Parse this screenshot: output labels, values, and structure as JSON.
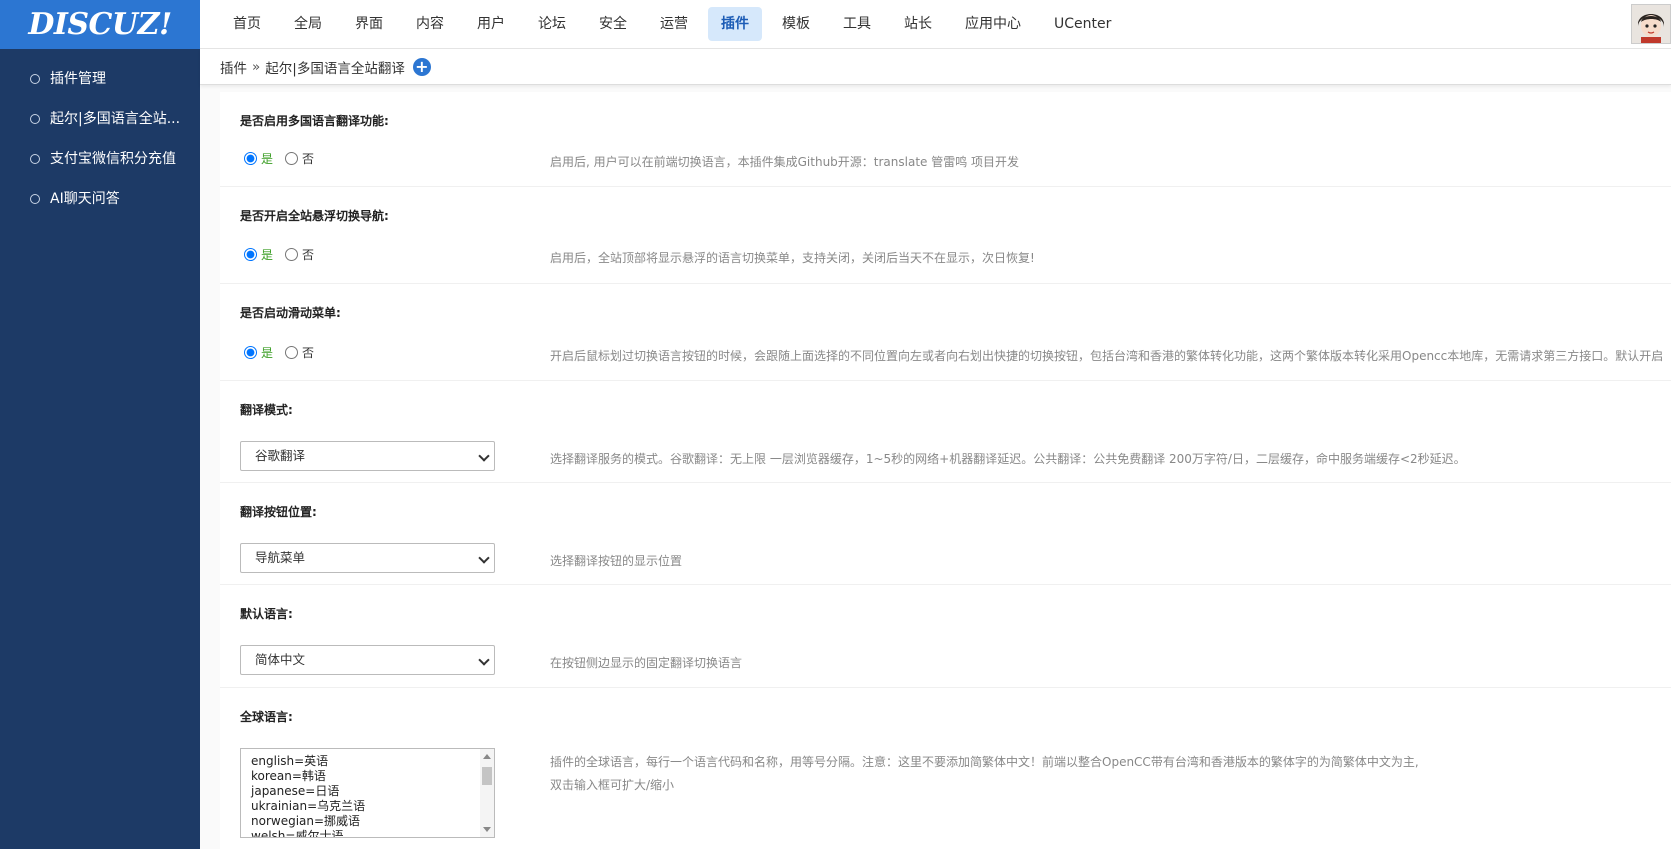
{
  "logo": {
    "text": "DISCUZ!"
  },
  "nav": {
    "items": [
      "首页",
      "全局",
      "界面",
      "内容",
      "用户",
      "论坛",
      "安全",
      "运营",
      "插件",
      "模板",
      "工具",
      "站长",
      "应用中心",
      "UCenter"
    ],
    "active_index": 8
  },
  "sidebar": {
    "items": [
      {
        "label": "插件管理"
      },
      {
        "label": "起尔|多国语言全站..."
      },
      {
        "label": "支付宝微信积分充值"
      },
      {
        "label": "AI聊天问答"
      }
    ]
  },
  "breadcrumb": {
    "root": "插件",
    "sep": "»",
    "current": "起尔|多国语言全站翻译",
    "add_icon": "+"
  },
  "settings": {
    "enable_translate": {
      "label": "是否启用多国语言翻译功能:",
      "yes": "是",
      "no": "否",
      "selected": "yes",
      "tip": "启用后, 用户可以在前端切换语言，本插件集成Github开源：translate 管雷鸣 项目开发"
    },
    "floating_nav": {
      "label": "是否开启全站悬浮切换导航:",
      "yes": "是",
      "no": "否",
      "selected": "yes",
      "tip": "启用后，全站顶部将显示悬浮的语言切换菜单，支持关闭，关闭后当天不在显示，次日恢复!"
    },
    "slide_menu": {
      "label": "是否启动滑动菜单:",
      "yes": "是",
      "no": "否",
      "selected": "yes",
      "tip": "开启后鼠标划过切换语言按钮的时候，会跟随上面选择的不同位置向左或者向右划出快捷的切换按钮，包括台湾和香港的繁体转化功能，这两个繁体版本转化采用Opencc本地库，无需请求第三方接口。默认开启"
    },
    "mode": {
      "label": "翻译模式:",
      "value": "谷歌翻译",
      "tip": "选择翻译服务的模式。谷歌翻译：无上限 一层浏览器缓存，1~5秒的网络+机器翻译延迟。公共翻译：公共免费翻译 200万字符/日，二层缓存，命中服务端缓存<2秒延迟。"
    },
    "button_position": {
      "label": "翻译按钮位置:",
      "value": "导航菜单",
      "tip": "选择翻译按钮的显示位置"
    },
    "default_lang": {
      "label": "默认语言:",
      "value": "简体中文",
      "tip": "在按钮侧边显示的固定翻译切换语言"
    },
    "global_lang": {
      "label": "全球语言:",
      "lines": [
        "english=英语",
        "korean=韩语",
        "japanese=日语",
        "ukrainian=乌克兰语",
        "norwegian=挪威语",
        "welsh=威尔士语"
      ],
      "tip1": "插件的全球语言，每行一个语言代码和名称，用等号分隔。注意：这里不要添加简繁体中文！前端以整合OpenCC带有台湾和香港版本的繁体字的为简繁体中文为主,",
      "tip2": "双击输入框可扩大/缩小"
    }
  }
}
